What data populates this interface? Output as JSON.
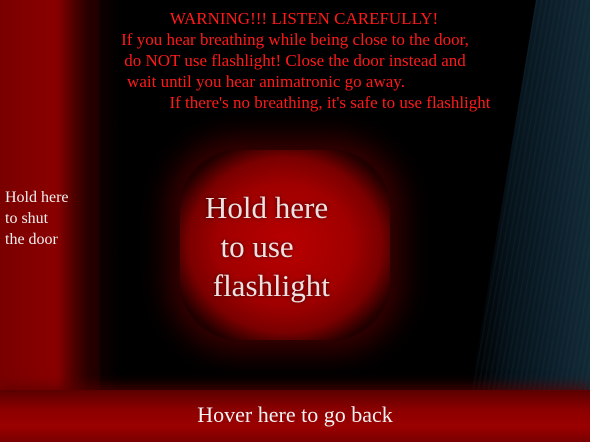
{
  "warning": {
    "lines": [
      "WARNING!!! LISTEN CAREFULLY!",
      "If you hear breathing while being close to the door,",
      "do NOT use flashlight! Close the door instead and",
      "wait until you hear animatronic go away.",
      "If there's no breathing, it's safe to use flashlight"
    ]
  },
  "door_button": {
    "label": "Hold here\nto shut\nthe door"
  },
  "flashlight_button": {
    "label": "Hold here\n  to use\n flashlight"
  },
  "back_button": {
    "label": "Hover here to go back"
  },
  "colors": {
    "warning_text": "#ff1a1a",
    "panel_red": "#8a0000",
    "background": "#000000"
  }
}
